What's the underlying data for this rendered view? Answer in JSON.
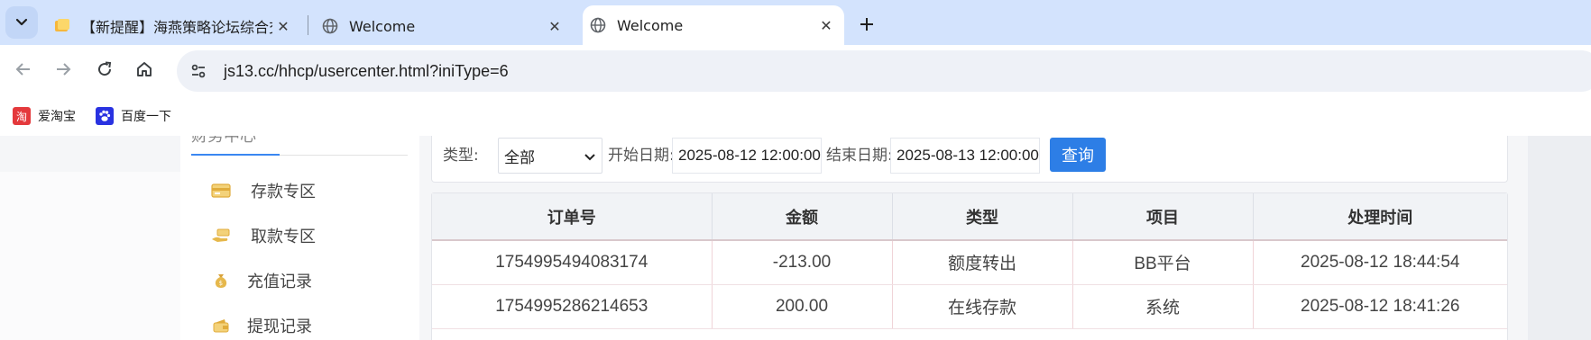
{
  "browser": {
    "tabs": [
      {
        "title": "【新提醒】海燕策略论坛综合交",
        "icon": "folder-note-icon",
        "active": false
      },
      {
        "title": "Welcome",
        "icon": "globe-icon",
        "active": false
      },
      {
        "title": "Welcome",
        "icon": "globe-icon",
        "active": true
      }
    ],
    "url": "js13.cc/hhcp/usercenter.html?iniType=6",
    "bookmarks": [
      {
        "label": "爱淘宝",
        "icon": "taobao-icon",
        "color": "#e4393c"
      },
      {
        "label": "百度一下",
        "icon": "baidu-paw-icon",
        "color": "#2932e1"
      }
    ]
  },
  "sidebar": {
    "section_title": "财务中心",
    "items": [
      {
        "label": "存款专区",
        "icon": "card-icon"
      },
      {
        "label": "取款专区",
        "icon": "hand-money-icon"
      },
      {
        "label": "充值记录",
        "icon": "money-bag-icon"
      },
      {
        "label": "提现记录",
        "icon": "wallet-icon"
      }
    ]
  },
  "filter": {
    "type_label": "类型:",
    "type_value": "全部",
    "start_label": "开始日期:",
    "start_value": "2025-08-12 12:00:00",
    "end_label": "结束日期:",
    "end_value": "2025-08-13 12:00:00",
    "query_button": "查询"
  },
  "table": {
    "columns": [
      "订单号",
      "金额",
      "类型",
      "项目",
      "处理时间"
    ],
    "rows": [
      [
        "1754995494083174",
        "-213.00",
        "额度转出",
        "BB平台",
        "2025-08-12 18:44:54"
      ],
      [
        "1754995286214653",
        "200.00",
        "在线存款",
        "系统",
        "2025-08-12 18:41:26"
      ]
    ]
  },
  "colors": {
    "accent": "#2d7ee6",
    "tabstrip": "#d3e3fd",
    "icon_gold": "#e6b84c"
  }
}
